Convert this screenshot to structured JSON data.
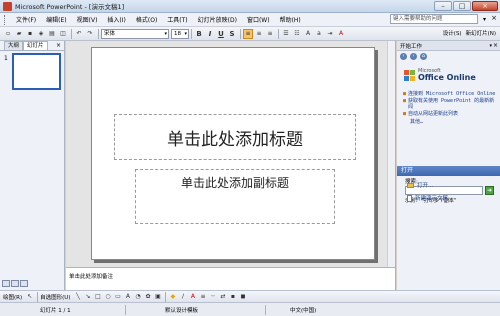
{
  "window": {
    "title": "Microsoft PowerPoint - [演示文稿1]"
  },
  "menu": {
    "items": [
      "文件(F)",
      "编辑(E)",
      "视图(V)",
      "插入(I)",
      "格式(O)",
      "工具(T)",
      "幻灯片放映(D)",
      "窗口(W)",
      "帮助(H)"
    ],
    "help_placeholder": "键入需要帮助的问题"
  },
  "toolbar": {
    "font": "宋体",
    "size": "18",
    "bold": "B",
    "italic": "I",
    "underline": "U",
    "shadow": "S",
    "design_label": "设计(S)",
    "new_slide_label": "新幻灯片(N)"
  },
  "outline": {
    "tabs": [
      "大纲",
      "幻灯片"
    ],
    "slide_number": "1"
  },
  "slide": {
    "title_placeholder": "单击此处添加标题",
    "subtitle_placeholder": "单击此处添加副标题"
  },
  "notes": {
    "placeholder": "单击此处添加备注"
  },
  "task_pane": {
    "title": "开始工作",
    "logo_small": "Microsoft",
    "logo_big": "Office Online",
    "links": [
      "连接到 Microsoft Office Online",
      "获取有关使用 PowerPoint 的最新新闻",
      "自动从网站更新此列表"
    ],
    "more": "其他…",
    "search_label": "搜索:",
    "example": "示例：  \"打印多个副本\"",
    "open_section": "打开",
    "open_item": "打开...",
    "new_item": "新建演示文稿..."
  },
  "drawbar": {
    "draw_label": "绘图(R)",
    "autoshapes_label": "自选图形(U)"
  },
  "status": {
    "slide": "幻灯片 1 / 1",
    "design": "默认设计模板",
    "language": "中文(中国)"
  }
}
